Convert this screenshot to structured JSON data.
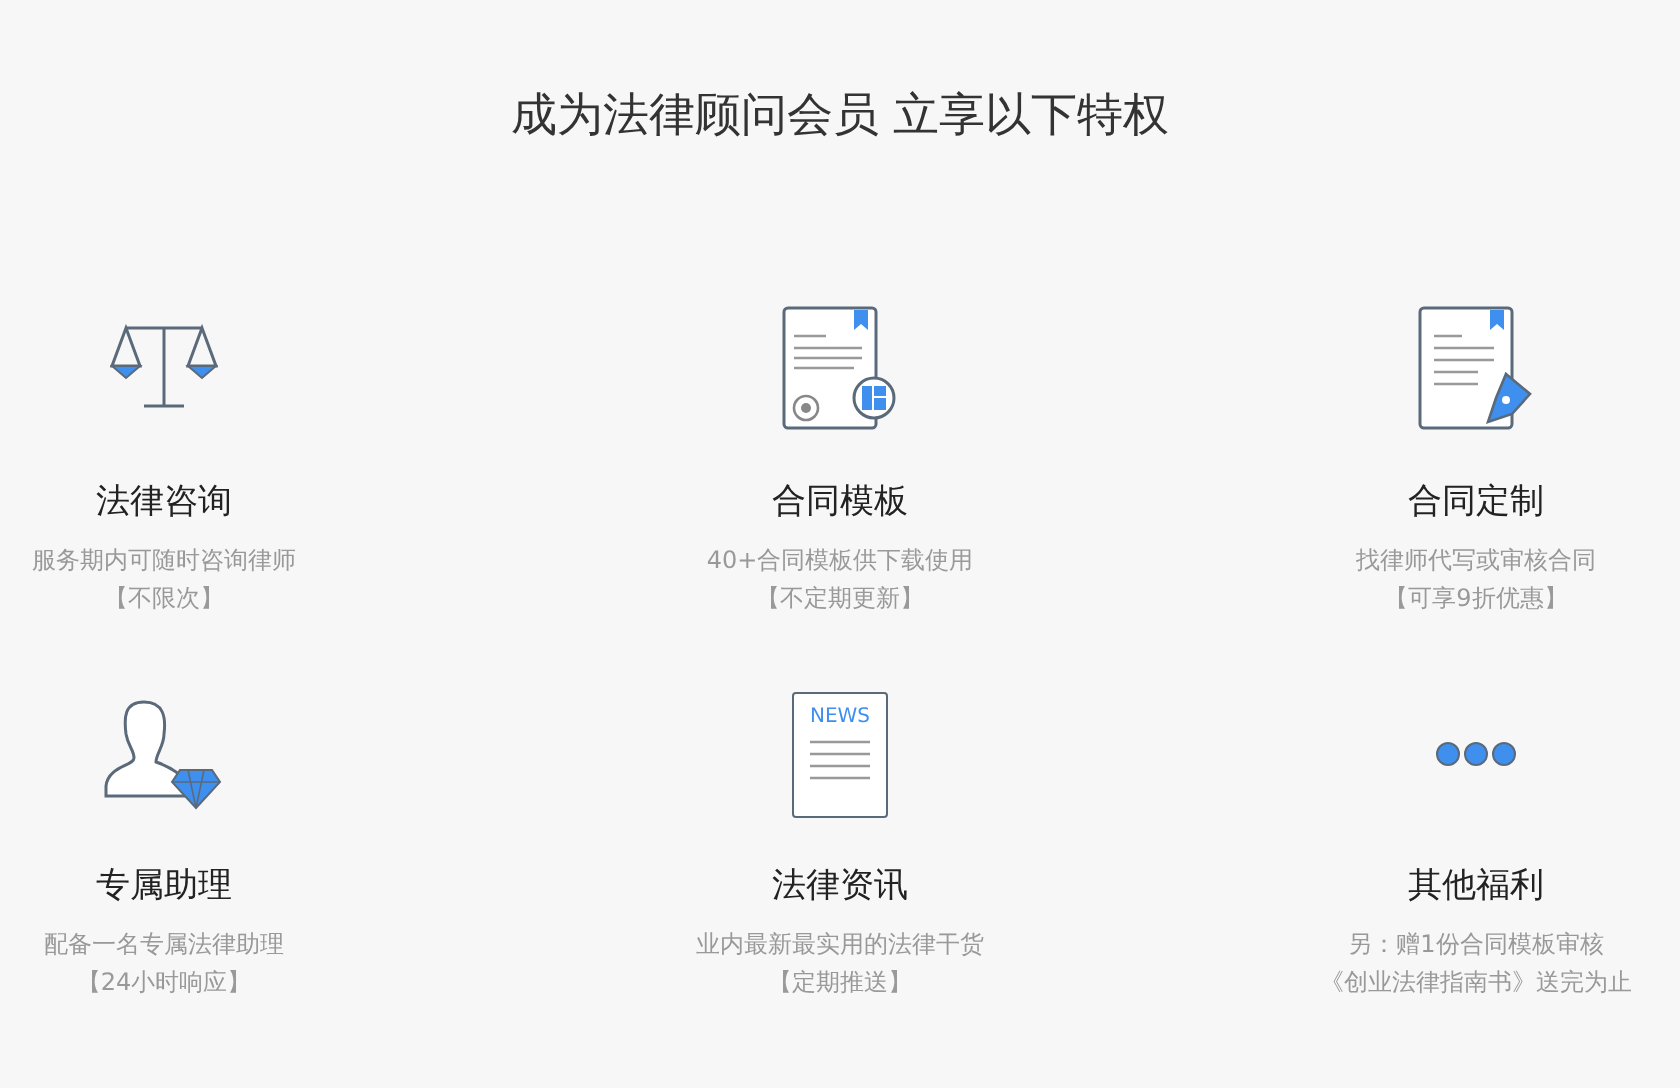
{
  "heading": "成为法律顾问会员 立享以下特权",
  "benefits": [
    {
      "kind": "scales",
      "title": "法律咨询",
      "lines": [
        "服务期内可随时咨询律师",
        "【不限次】"
      ]
    },
    {
      "kind": "template",
      "title": "合同模板",
      "lines": [
        "40+合同模板供下载使用",
        "【不定期更新】"
      ]
    },
    {
      "kind": "drafting",
      "title": "合同定制",
      "lines": [
        "找律师代写或审核合同",
        "【可享9折优惠】"
      ]
    },
    {
      "kind": "assistant",
      "title": "专属助理",
      "lines": [
        "配备一名专属法律助理",
        "【24小时响应】"
      ]
    },
    {
      "kind": "news",
      "icon_label": "NEWS",
      "title": "法律资讯",
      "lines": [
        "业内最新最实用的法律干货",
        "【定期推送】"
      ]
    },
    {
      "kind": "more",
      "title": "其他福利",
      "lines": [
        "另：赠1份合同模板审核",
        "《创业法律指南书》送完为止"
      ]
    }
  ]
}
